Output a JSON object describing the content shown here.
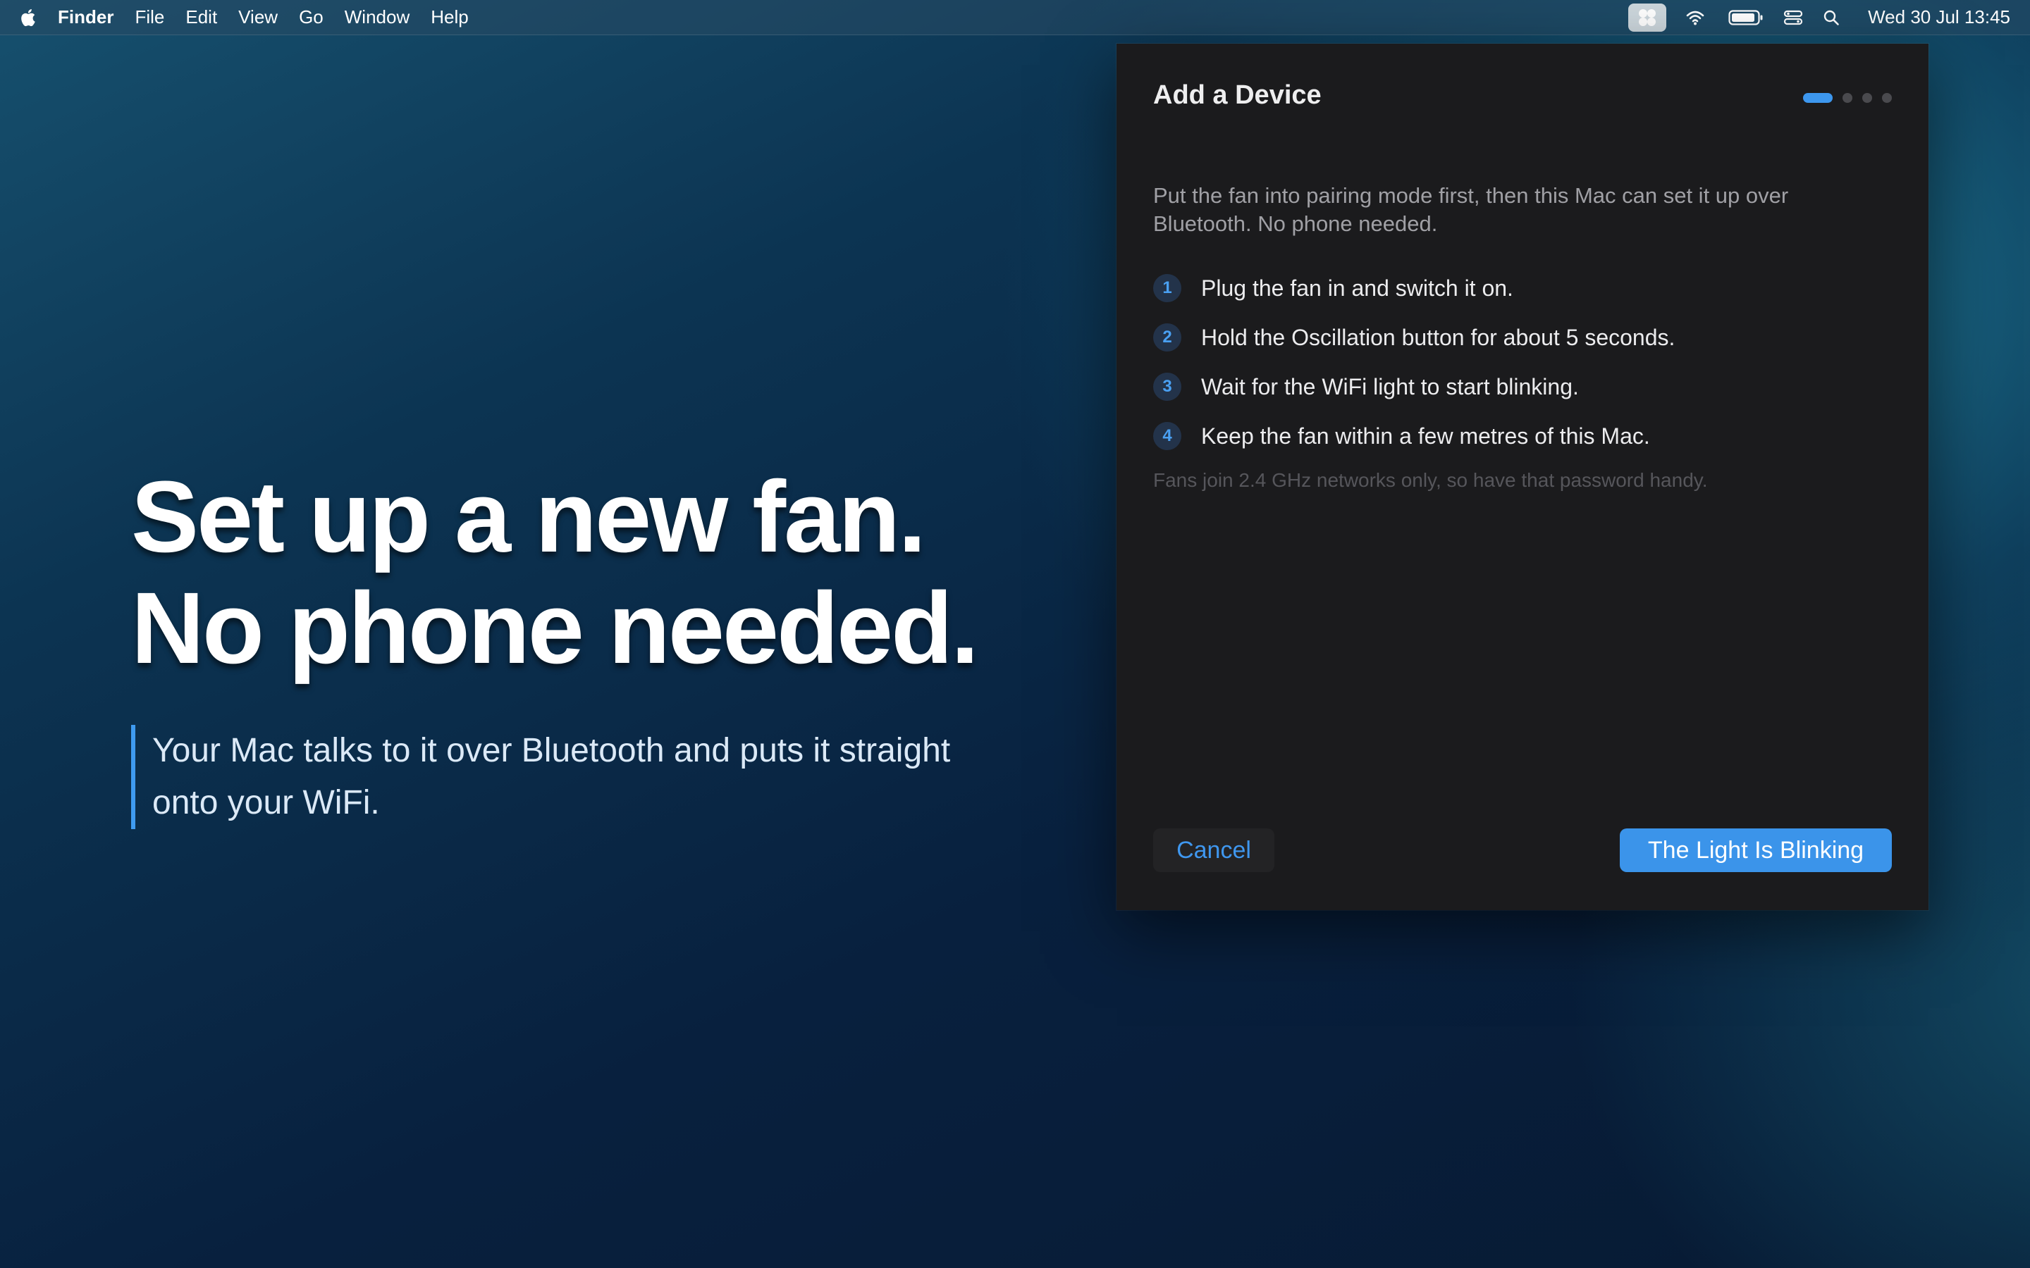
{
  "menubar": {
    "apple_icon": "apple-logo-icon",
    "app_name": "Finder",
    "menus": [
      "File",
      "Edit",
      "View",
      "Go",
      "Window",
      "Help"
    ],
    "status_icons": [
      "control-centre-icon",
      "wifi-icon",
      "battery-icon",
      "display-icon",
      "search-icon"
    ],
    "clock": "Wed 30 Jul  13:45"
  },
  "hero": {
    "headline_line1": "Set up a new fan.",
    "headline_line2": "No phone needed.",
    "subtext": "Your Mac talks to it over Bluetooth and puts it straight onto your WiFi.",
    "accent_color": "#3f9bf0"
  },
  "dialog": {
    "title": "Add a Device",
    "pager": {
      "total_pages": 4,
      "current_page": 1
    },
    "intro": "Put the fan into pairing mode first, then this Mac can set it up over Bluetooth. No phone needed.",
    "steps": [
      {
        "number": "1",
        "text": "Plug the fan in and switch it on."
      },
      {
        "number": "2",
        "text": "Hold the Oscillation button for about 5 seconds."
      },
      {
        "number": "3",
        "text": "Wait for the WiFi light to start blinking."
      },
      {
        "number": "4",
        "text": "Keep the fan within a few metres of this Mac."
      }
    ],
    "note": "Fans join 2.4 GHz networks only, so have that password handy.",
    "cancel_label": "Cancel",
    "primary_label": "The Light Is Blinking",
    "accent_color": "#3b94ea"
  }
}
